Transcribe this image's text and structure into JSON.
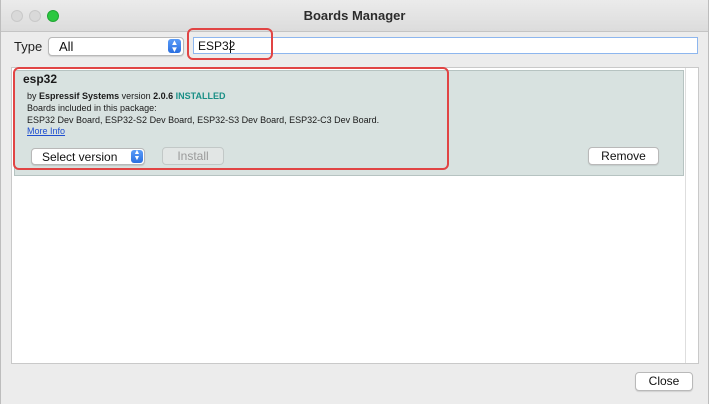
{
  "window": {
    "title": "Boards Manager"
  },
  "filter": {
    "type_label": "Type",
    "type_value": "All",
    "search_value": "ESP32"
  },
  "boards": [
    {
      "name": "esp32",
      "by_prefix": "by",
      "author": "Espressif Systems",
      "version_label": "version",
      "version": "2.0.6",
      "status": "INSTALLED",
      "included_label": "Boards included in this package:",
      "included_boards": "ESP32 Dev Board, ESP32-S2 Dev Board, ESP32-S3 Dev Board, ESP32-C3 Dev Board.",
      "more_info": "More Info",
      "select_version": "Select version",
      "install_label": "Install",
      "remove_label": "Remove"
    }
  ],
  "footer": {
    "close_label": "Close"
  },
  "colors": {
    "highlight": "#e14444",
    "installed": "#1a8f86",
    "link": "#1f4fd0",
    "item_bg": "#d8e2e0",
    "accent": "#2a6fe0"
  },
  "icons": {
    "select_arrow": "chevron-up-down-icon"
  }
}
